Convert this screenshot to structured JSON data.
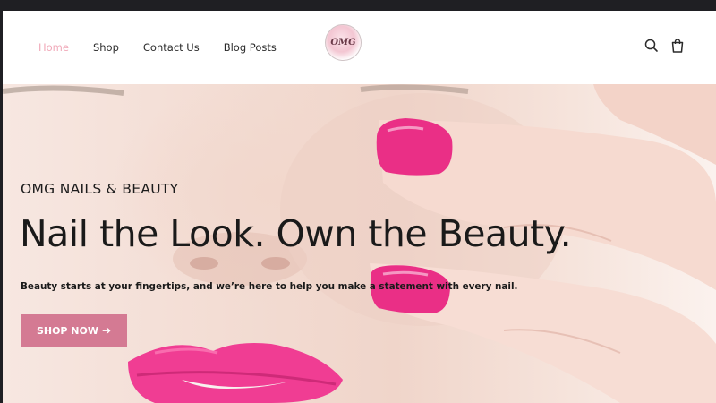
{
  "nav": {
    "items": [
      {
        "label": "Home",
        "active": true
      },
      {
        "label": "Shop"
      },
      {
        "label": "Contact Us"
      },
      {
        "label": "Blog Posts"
      }
    ]
  },
  "logo": {
    "text": "OMG"
  },
  "header_icons": {
    "search": "search-icon",
    "bag": "shopping-bag-icon"
  },
  "hero": {
    "kicker": "OMG NAILS & BEAUTY",
    "headline": "Nail the Look. Own the Beauty.",
    "subline": "Beauty starts at your fingertips, and we’re here to help you make a statement with every nail.",
    "cta_label": "SHOP NOW",
    "cta_icon": "arrow-right-icon"
  },
  "colors": {
    "nav_active": "#f0a8b8",
    "cta_bg": "#d47a93",
    "nail_pink": "#ea2f86",
    "lip_pink": "#f03d93"
  }
}
